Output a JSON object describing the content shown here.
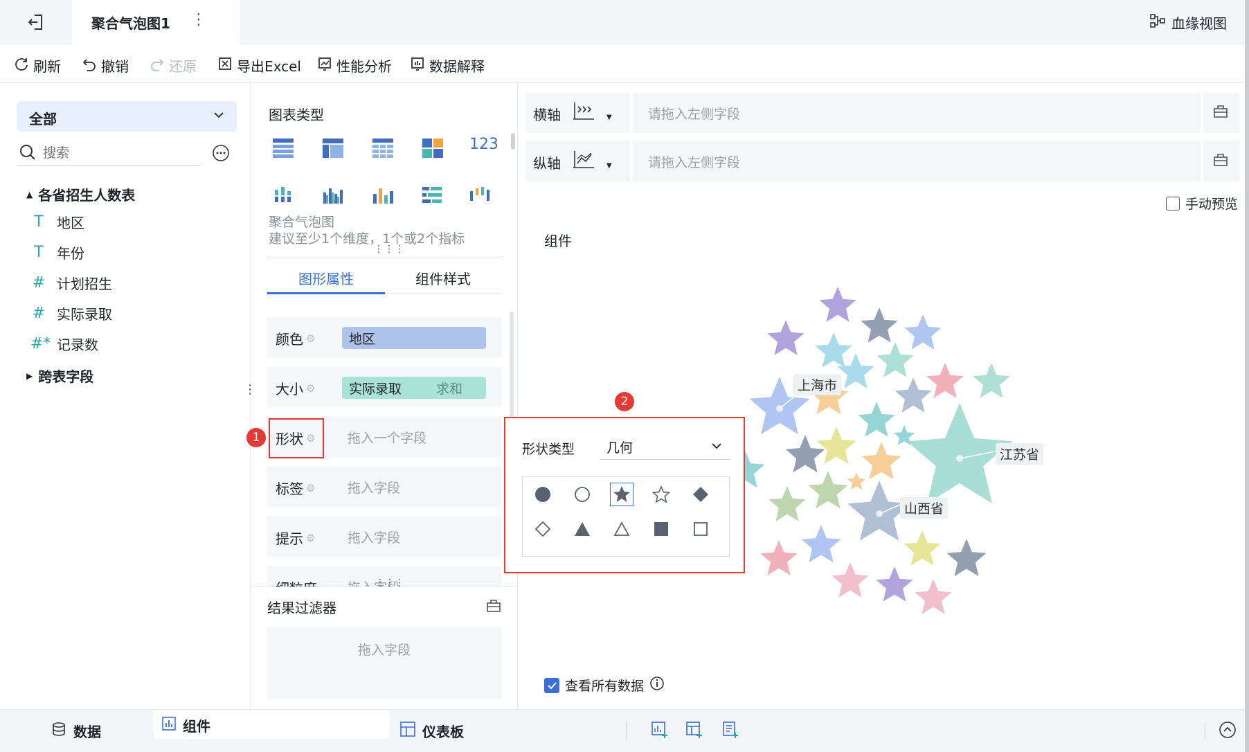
{
  "header": {
    "title": "聚合气泡图1",
    "lineage_label": "血缘视图"
  },
  "toolbar": {
    "refresh": "刷新",
    "undo": "撤销",
    "redo": "还原",
    "export_excel": "导出Excel",
    "performance": "性能分析",
    "data_explain": "数据解释"
  },
  "left": {
    "dropdown_value": "全部",
    "search_placeholder": "搜索",
    "table_name": "各省招生人数表",
    "fields": [
      {
        "icon": "T",
        "label": "地区"
      },
      {
        "icon": "T",
        "label": "年份"
      },
      {
        "icon": "#",
        "label": "计划招生"
      },
      {
        "icon": "#",
        "label": "实际录取"
      },
      {
        "icon": "#*",
        "label": "记录数"
      }
    ],
    "cross_table": "跨表字段"
  },
  "middle": {
    "chart_type_label": "图表类型",
    "chart_name": "聚合气泡图",
    "chart_hint": "建议至少1个维度，1个或2个指标",
    "tabs": [
      "图形属性",
      "组件样式"
    ],
    "props": [
      {
        "label": "颜色",
        "value": "地区"
      },
      {
        "label": "大小",
        "value": "实际录取",
        "agg": "求和"
      },
      {
        "label": "形状",
        "placeholder": "拖入一个字段"
      },
      {
        "label": "标签",
        "placeholder": "拖入字段"
      },
      {
        "label": "提示",
        "placeholder": "拖入字段"
      },
      {
        "label": "细粒度",
        "placeholder": "拖入字段"
      }
    ],
    "filter_title": "结果过滤器",
    "filter_placeholder": "拖入字段"
  },
  "right": {
    "x_axis_label": "横轴",
    "y_axis_label": "纵轴",
    "axis_placeholder": "请拖入左侧字段",
    "manual_preview": "手动预览",
    "component_label": "组件",
    "view_all_data": "查看所有数据",
    "chart_labels": [
      "上海市",
      "江苏省",
      "山西省"
    ]
  },
  "popup": {
    "marker1": "1",
    "marker2": "2",
    "shape_type_label": "形状类型",
    "shape_type_value": "几何",
    "shapes": [
      "filled-circle",
      "hollow-circle",
      "filled-star",
      "hollow-star",
      "filled-diamond",
      "hollow-diamond",
      "filled-triangle",
      "hollow-triangle",
      "filled-square",
      "hollow-square"
    ],
    "selected_shape": "filled-star",
    "highlight_color": "#e53935"
  },
  "bottom": {
    "tabs": [
      "数据",
      "组件",
      "仪表板"
    ]
  }
}
